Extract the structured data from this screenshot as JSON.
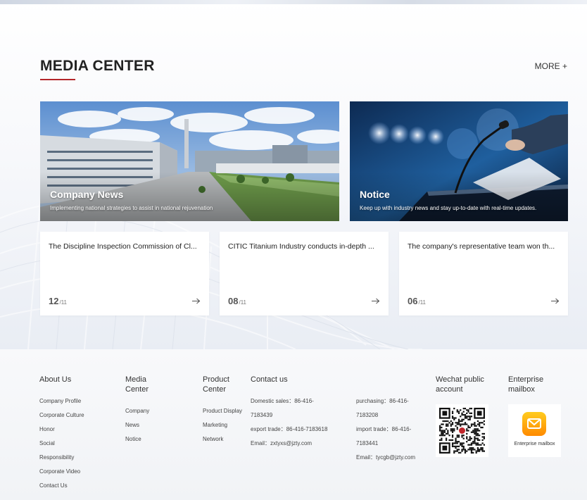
{
  "media": {
    "title": "MEDIA CENTER",
    "more_label": "MORE +",
    "features": [
      {
        "title": "Company News",
        "desc": "Implementing national strategies to assist in national rejuvenation"
      },
      {
        "title": "Notice",
        "desc": "Keep up with industry news and stay up-to-date with real-time updates."
      }
    ],
    "cards": [
      {
        "title": "The Discipline Inspection Commission of Cl...",
        "day": "12",
        "month": "/11"
      },
      {
        "title": "CITIC Titanium Industry conducts in-depth ...",
        "day": "08",
        "month": "/11"
      },
      {
        "title": "The company's representative team won th...",
        "day": "06",
        "month": "/11"
      }
    ]
  },
  "footer": {
    "about": {
      "title": "About Us",
      "links": [
        "Company Profile",
        "Corporate Culture",
        "Honor",
        "Social",
        "Responsibility",
        "Corporate Video",
        "Contact Us"
      ]
    },
    "media": {
      "title_line1": "Media",
      "title_line2": "Center",
      "links": [
        "Company",
        "News",
        "Notice"
      ]
    },
    "product": {
      "title_line1": "Product",
      "title_line2": "Center",
      "links": [
        "Product Display",
        "Marketing",
        "Network"
      ]
    },
    "contact": {
      "title": "Contact us",
      "left": [
        "Domestic sales：86-416-",
        "7183439",
        "export trade：86-416-7183618",
        "Email：zxtyxs@jzty.com"
      ],
      "right": [
        "purchasing：86-416-",
        "7183208",
        "import trade：86-416-",
        "7183441",
        "Email：tycgb@jzty.com"
      ]
    },
    "wechat": {
      "title_line1": "Wechat public",
      "title_line2": "account"
    },
    "mailbox": {
      "title_line1": "Enterprise",
      "title_line2": "mailbox",
      "label": "Enterprise mailbox"
    }
  },
  "colors": {
    "accent": "#b3262a",
    "mail_icon_top": "#ffcc1f",
    "mail_icon_bottom": "#ff8a00"
  }
}
